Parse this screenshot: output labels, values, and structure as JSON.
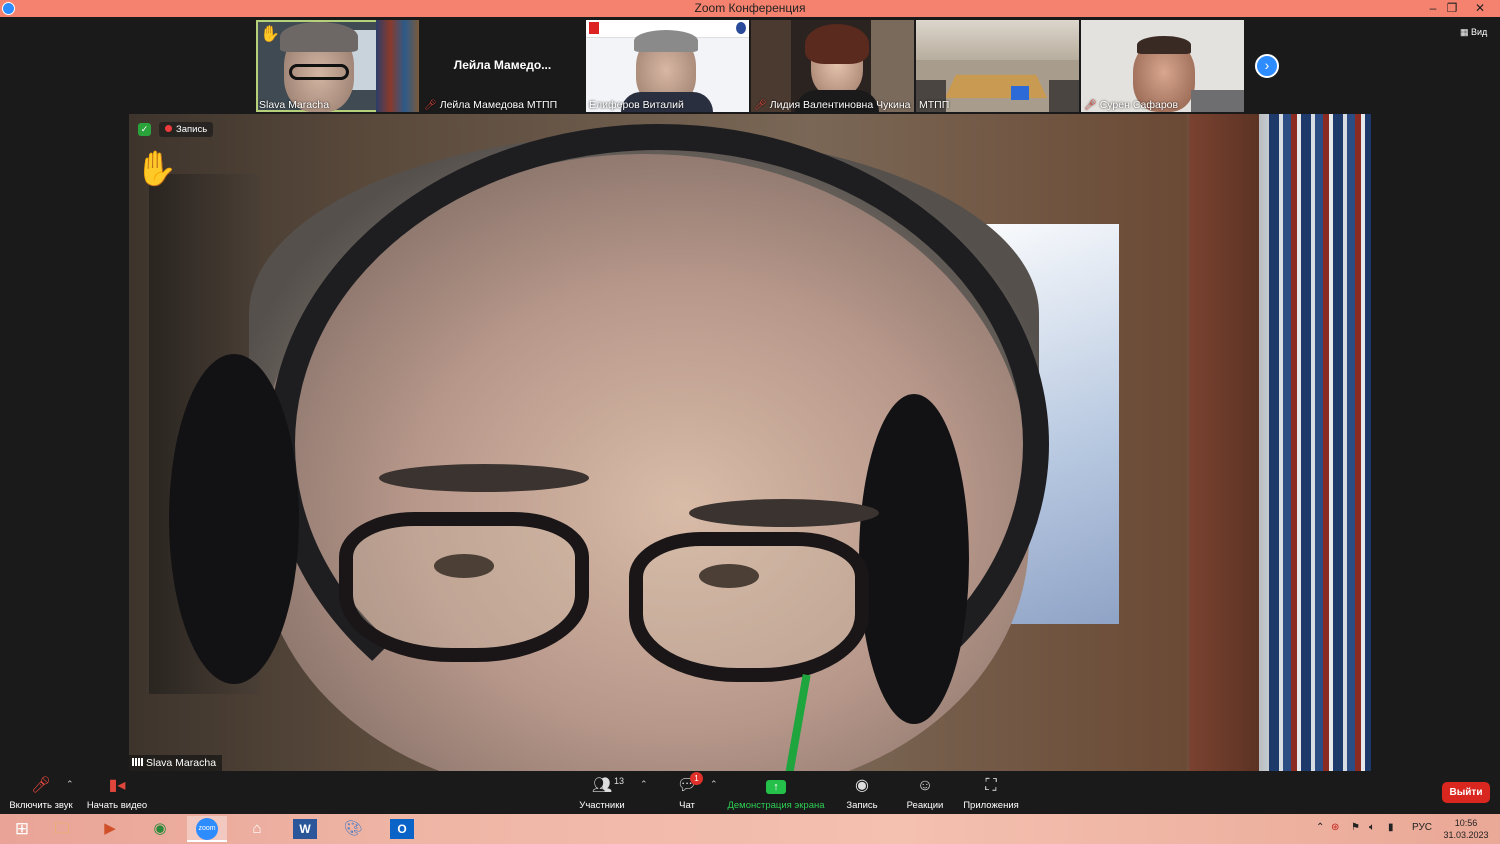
{
  "window": {
    "title": "Zoom Конференция",
    "minimize": "–",
    "restore": "❐",
    "close": "✕"
  },
  "gallery": {
    "view_label": "Вид",
    "next_icon": "›",
    "tiles": [
      {
        "name": "Slava Maracha",
        "hand_raised": true,
        "muted": false
      },
      {
        "name": "Лейла Мамедова МТПП",
        "display_name_short": "Лейла  Мамедо...",
        "muted": true
      },
      {
        "name": "Елиферов Виталий",
        "muted": false
      },
      {
        "name": "Лидия Валентиновна Чукина",
        "muted": true
      },
      {
        "name": "МТПП",
        "muted": false
      },
      {
        "name": "Сурен Сафаров",
        "muted": true
      }
    ]
  },
  "main_video": {
    "recording_label": "Запись",
    "speaker_name": "Slava Maracha",
    "raise_hand_icon": "✋"
  },
  "toolbar": {
    "unmute": "Включить звук",
    "start_video": "Начать видео",
    "participants": "Участники",
    "participants_count": "13",
    "chat": "Чат",
    "chat_unread": "1",
    "share_screen": "Демонстрация экрана",
    "record": "Запись",
    "reactions": "Реакции",
    "apps": "Приложения",
    "leave": "Выйти"
  },
  "taskbar": {
    "language": "РУС",
    "time": "10:56",
    "date": "31.03.2023"
  },
  "colors": {
    "titlebar": "#f4826f",
    "leave": "#d9271f",
    "share": "#24c04a",
    "zoom_blue": "#2d8cff"
  }
}
